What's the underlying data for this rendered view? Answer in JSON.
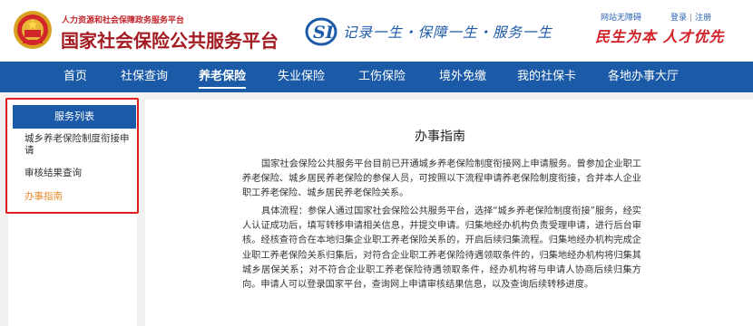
{
  "header": {
    "dept": "人力资源和社会保障政务服务平台",
    "title": "国家社会保险公共服务平台",
    "slogan": "记录一生・保障一生・服务一生",
    "motto": "民生为本 人才优先",
    "accessibility_link": "网站无障碍",
    "login_link": "登录",
    "register_link": "注册",
    "separator": "|"
  },
  "nav": {
    "items": [
      {
        "label": "首页"
      },
      {
        "label": "社保查询"
      },
      {
        "label": "养老保险"
      },
      {
        "label": "失业保险"
      },
      {
        "label": "工伤保险"
      },
      {
        "label": "境外免缴"
      },
      {
        "label": "我的社保卡"
      },
      {
        "label": "各地办事大厅"
      }
    ],
    "active_index": 2
  },
  "sidebar": {
    "title": "服务列表",
    "items": [
      {
        "label": "城乡养老保险制度衔接申请"
      },
      {
        "label": "审核结果查询"
      },
      {
        "label": "办事指南"
      }
    ]
  },
  "main": {
    "title": "办事指南",
    "para1": "国家社会保险公共服务平台目前已开通城乡养老保险制度衔接网上申请服务。曾参加企业职工养老保险、城乡居民养老保险的参保人员，可按照以下流程申请养老保险制度衔接，合并本人企业职工养老保险、城乡居民养老保险关系。",
    "para2": "具体流程：参保人通过国家社会保险公共服务平台，选择“城乡养老保险制度衔接”服务，经实人认证成功后，填写转移申请相关信息，并提交申请。归集地经办机构负责受理申请，进行后台审核。经核查符合在本地归集企业职工养老保险关系的，开启后续归集流程。归集地经办机构完成企业职工养老保险关系归集后，对符合企业职工养老保险待遇领取条件的，归集地经办机构将归集其城乡居保关系；对不符合企业职工养老保险待遇领取条件，经办机构将与申请人协商后续归集方向。申请人可以登录国家平台，查询网上申请审核结果信息，以及查询后续转移进度。"
  },
  "colors": {
    "brand_red": "#a31c22",
    "nav_blue": "#1a5aa6",
    "active_orange": "#e9892a",
    "highlight_red": "#e0201f"
  }
}
